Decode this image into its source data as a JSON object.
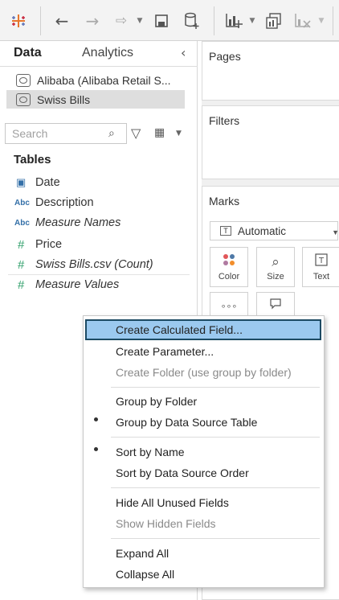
{
  "toolbar": {
    "icons": [
      "tableau-logo-icon",
      "back-arrow-icon",
      "forward-arrow-icon",
      "redo-icon",
      "save-icon",
      "new-datasource-icon",
      "new-worksheet-icon",
      "duplicate-icon",
      "clear-icon"
    ]
  },
  "left_pane": {
    "tabs": {
      "data": "Data",
      "analytics": "Analytics"
    },
    "data_sources": [
      {
        "label": "Alibaba (Alibaba Retail S...",
        "selected": false
      },
      {
        "label": "Swiss Bills",
        "selected": true
      }
    ],
    "search": {
      "placeholder": "Search"
    },
    "tables_heading": "Tables",
    "fields": [
      {
        "type_icon": "date",
        "label": "Date"
      },
      {
        "type_icon": "Abc",
        "label": "Description"
      },
      {
        "type_icon": "Abc",
        "label": "Measure Names"
      },
      {
        "type_icon": "#",
        "label": "Price"
      },
      {
        "type_icon": "#",
        "label": "Swiss Bills.csv (Count)"
      },
      {
        "type_icon": "#",
        "label": "Measure Values"
      }
    ]
  },
  "right_pane": {
    "pages_title": "Pages",
    "filters_title": "Filters",
    "marks_title": "Marks",
    "mark_type": "Automatic",
    "mark_buttons": [
      "Color",
      "Size",
      "Text"
    ]
  },
  "context_menu": {
    "items": [
      {
        "label": "Create Calculated Field...",
        "state": "highlighted"
      },
      {
        "label": "Create Parameter...",
        "state": "enabled"
      },
      {
        "label": "Create Folder (use group by folder)",
        "state": "disabled"
      },
      {
        "label": "Group by Folder",
        "state": "enabled"
      },
      {
        "label": "Group by Data Source Table",
        "state": "checked"
      },
      {
        "label": "Sort by Name",
        "state": "checked"
      },
      {
        "label": "Sort by Data Source Order",
        "state": "enabled"
      },
      {
        "label": "Hide All Unused Fields",
        "state": "enabled"
      },
      {
        "label": "Show Hidden Fields",
        "state": "disabled"
      },
      {
        "label": "Expand All",
        "state": "enabled"
      },
      {
        "label": "Collapse All",
        "state": "enabled"
      }
    ]
  },
  "colors": {
    "menu_highlight": "#9bc9ef",
    "menu_highlight_border": "#1c4a63",
    "dimension_icon": "#3470a8",
    "measure_icon": "#32a06c"
  }
}
